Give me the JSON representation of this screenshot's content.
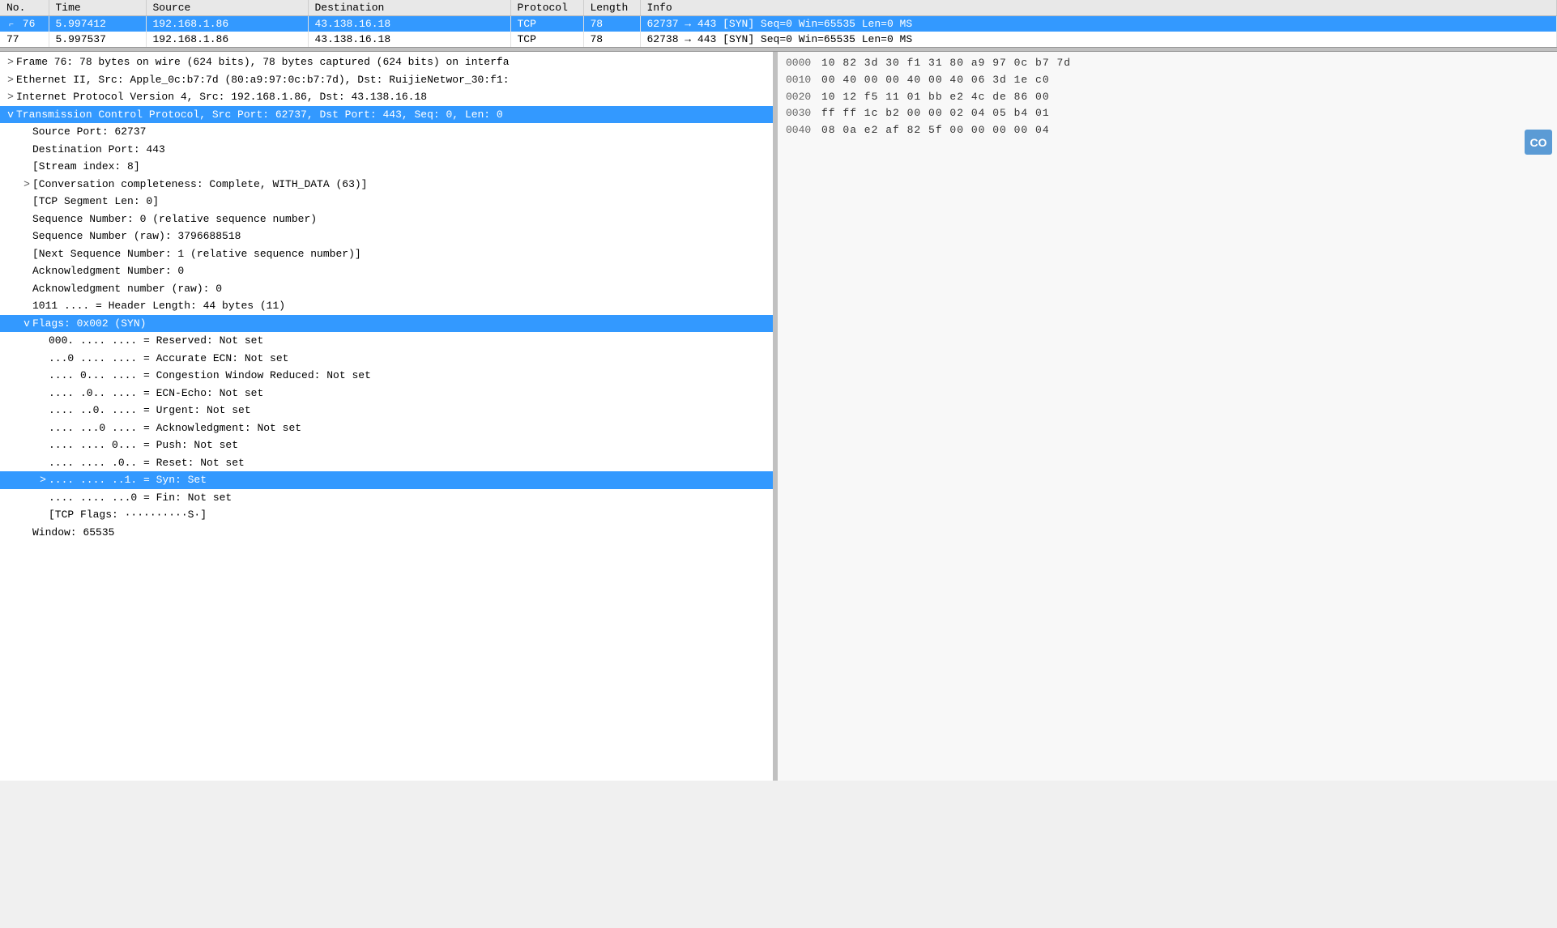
{
  "table": {
    "columns": [
      "No.",
      "Time",
      "Source",
      "Destination",
      "Protocol",
      "Length",
      "Info"
    ],
    "rows": [
      {
        "no": "76",
        "time": "5.997412",
        "source": "192.168.1.86",
        "destination": "43.138.16.18",
        "protocol": "TCP",
        "length": "78",
        "info": "62737 → 443  [SYN]  Seq=0  Win=65535  Len=0  MS",
        "selected": true
      },
      {
        "no": "77",
        "time": "5.997537",
        "source": "192.168.1.86",
        "destination": "43.138.16.18",
        "protocol": "TCP",
        "length": "78",
        "info": "62738 → 443  [SYN]  Seq=0  Win=65535  Len=0  MS",
        "selected": false
      }
    ]
  },
  "detail": {
    "rows": [
      {
        "indent": 0,
        "expand": ">",
        "text": "Frame 76: 78 bytes on wire (624 bits), 78 bytes captured (624 bits) on interfa",
        "highlighted": false
      },
      {
        "indent": 0,
        "expand": ">",
        "text": "Ethernet II, Src: Apple_0c:b7:7d (80:a9:97:0c:b7:7d), Dst: RuijieNetwor_30:f1:",
        "highlighted": false
      },
      {
        "indent": 0,
        "expand": ">",
        "text": "Internet Protocol Version 4, Src: 192.168.1.86, Dst: 43.138.16.18",
        "highlighted": false
      },
      {
        "indent": 0,
        "expand": "v",
        "text": "Transmission Control Protocol, Src Port: 62737, Dst Port: 443, Seq: 0, Len: 0",
        "highlighted": true
      },
      {
        "indent": 1,
        "expand": "",
        "text": "Source Port: 62737",
        "highlighted": false
      },
      {
        "indent": 1,
        "expand": "",
        "text": "Destination Port: 443",
        "highlighted": false
      },
      {
        "indent": 1,
        "expand": "",
        "text": "[Stream index: 8]",
        "highlighted": false
      },
      {
        "indent": 1,
        "expand": ">",
        "text": "[Conversation completeness: Complete, WITH_DATA (63)]",
        "highlighted": false
      },
      {
        "indent": 1,
        "expand": "",
        "text": "[TCP Segment Len: 0]",
        "highlighted": false
      },
      {
        "indent": 1,
        "expand": "",
        "text": "Sequence Number: 0    (relative sequence number)",
        "highlighted": false
      },
      {
        "indent": 1,
        "expand": "",
        "text": "Sequence Number (raw): 3796688518",
        "highlighted": false
      },
      {
        "indent": 1,
        "expand": "",
        "text": "[Next Sequence Number: 1    (relative sequence number)]",
        "highlighted": false
      },
      {
        "indent": 1,
        "expand": "",
        "text": "Acknowledgment Number: 0",
        "highlighted": false
      },
      {
        "indent": 1,
        "expand": "",
        "text": "Acknowledgment number (raw): 0",
        "highlighted": false
      },
      {
        "indent": 1,
        "expand": "",
        "text": "1011 .... = Header Length: 44 bytes (11)",
        "highlighted": false
      },
      {
        "indent": 1,
        "expand": "v",
        "text": "Flags: 0x002 (SYN)",
        "highlighted": true
      },
      {
        "indent": 2,
        "expand": "",
        "text": "000. .... .... = Reserved: Not set",
        "highlighted": false
      },
      {
        "indent": 2,
        "expand": "",
        "text": "...0 .... .... = Accurate ECN: Not set",
        "highlighted": false
      },
      {
        "indent": 2,
        "expand": "",
        "text": ".... 0... .... = Congestion Window Reduced: Not set",
        "highlighted": false
      },
      {
        "indent": 2,
        "expand": "",
        "text": ".... .0.. .... = ECN-Echo: Not set",
        "highlighted": false
      },
      {
        "indent": 2,
        "expand": "",
        "text": ".... ..0. .... = Urgent: Not set",
        "highlighted": false
      },
      {
        "indent": 2,
        "expand": "",
        "text": ".... ...0 .... = Acknowledgment: Not set",
        "highlighted": false
      },
      {
        "indent": 2,
        "expand": "",
        "text": ".... .... 0... = Push: Not set",
        "highlighted": false
      },
      {
        "indent": 2,
        "expand": "",
        "text": ".... .... .0.. = Reset: Not set",
        "highlighted": false
      },
      {
        "indent": 2,
        "expand": ">",
        "text": ".... .... ..1. = Syn: Set",
        "highlighted": true
      },
      {
        "indent": 2,
        "expand": "",
        "text": ".... .... ...0 = Fin: Not set",
        "highlighted": false
      },
      {
        "indent": 2,
        "expand": "",
        "text": "[TCP Flags: ··········S·]",
        "highlighted": false
      },
      {
        "indent": 1,
        "expand": "",
        "text": "Window: 65535",
        "highlighted": false
      }
    ]
  },
  "hex": {
    "rows": [
      {
        "offset": "0000",
        "bytes": "10 82 3d 30  f1 31 80 a9  97 0c b7 7d"
      },
      {
        "offset": "0010",
        "bytes": "00 40 00 00  40 00 40 06  3d 1e c0"
      },
      {
        "offset": "0020",
        "bytes": "10 12 f5 11  01 bb e2 4c  de 86 00"
      },
      {
        "offset": "0030",
        "bytes": "ff ff 1c b2  00 00 02 04  05 b4 01"
      },
      {
        "offset": "0040",
        "bytes": "08 0a e2 af  82 5f 00 00  00 00 04"
      }
    ]
  },
  "avatar": {
    "label": "CO"
  }
}
